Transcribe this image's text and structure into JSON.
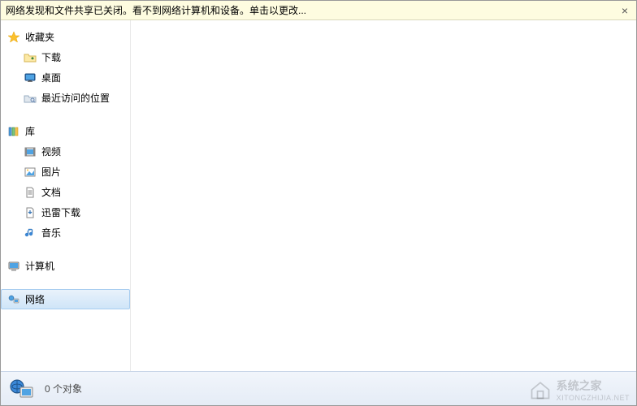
{
  "notification": {
    "text": "网络发现和文件共享已关闭。看不到网络计算机和设备。单击以更改...",
    "close_symbol": "×"
  },
  "sidebar": {
    "favorites": {
      "label": "收藏夹",
      "items": [
        {
          "label": "下载"
        },
        {
          "label": "桌面"
        },
        {
          "label": "最近访问的位置"
        }
      ]
    },
    "libraries": {
      "label": "库",
      "items": [
        {
          "label": "视频"
        },
        {
          "label": "图片"
        },
        {
          "label": "文档"
        },
        {
          "label": "迅雷下载"
        },
        {
          "label": "音乐"
        }
      ]
    },
    "computer": {
      "label": "计算机"
    },
    "network": {
      "label": "网络"
    }
  },
  "status": {
    "text": "0 个对象"
  },
  "watermark": {
    "title": "系统之家",
    "sub": "XITONGZHIJIA.NET"
  }
}
